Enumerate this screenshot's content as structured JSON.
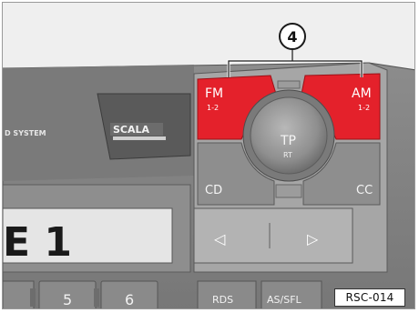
{
  "callout": {
    "number": "4"
  },
  "radio": {
    "brand_left": "D SYSTEM",
    "brand_logo": "SCALA",
    "buttons": {
      "fm": {
        "label": "FM",
        "sub": "1-2"
      },
      "am": {
        "label": "AM",
        "sub": "1-2"
      },
      "tp": {
        "label": "TP",
        "sub": "RT"
      },
      "cd": {
        "label": "CD"
      },
      "cc": {
        "label": "CC"
      }
    },
    "display_text": "E 1",
    "presets": [
      "5",
      "6"
    ],
    "bottom_buttons": [
      "RDS",
      "AS/SFL"
    ],
    "seek_left": "◁",
    "seek_right": "▷"
  },
  "reference": "RSC-014",
  "colors": {
    "highlight": "#e4212b",
    "panel": "#8a8a8a",
    "panel_dark": "#5f5f5f",
    "background": "#efefef"
  }
}
